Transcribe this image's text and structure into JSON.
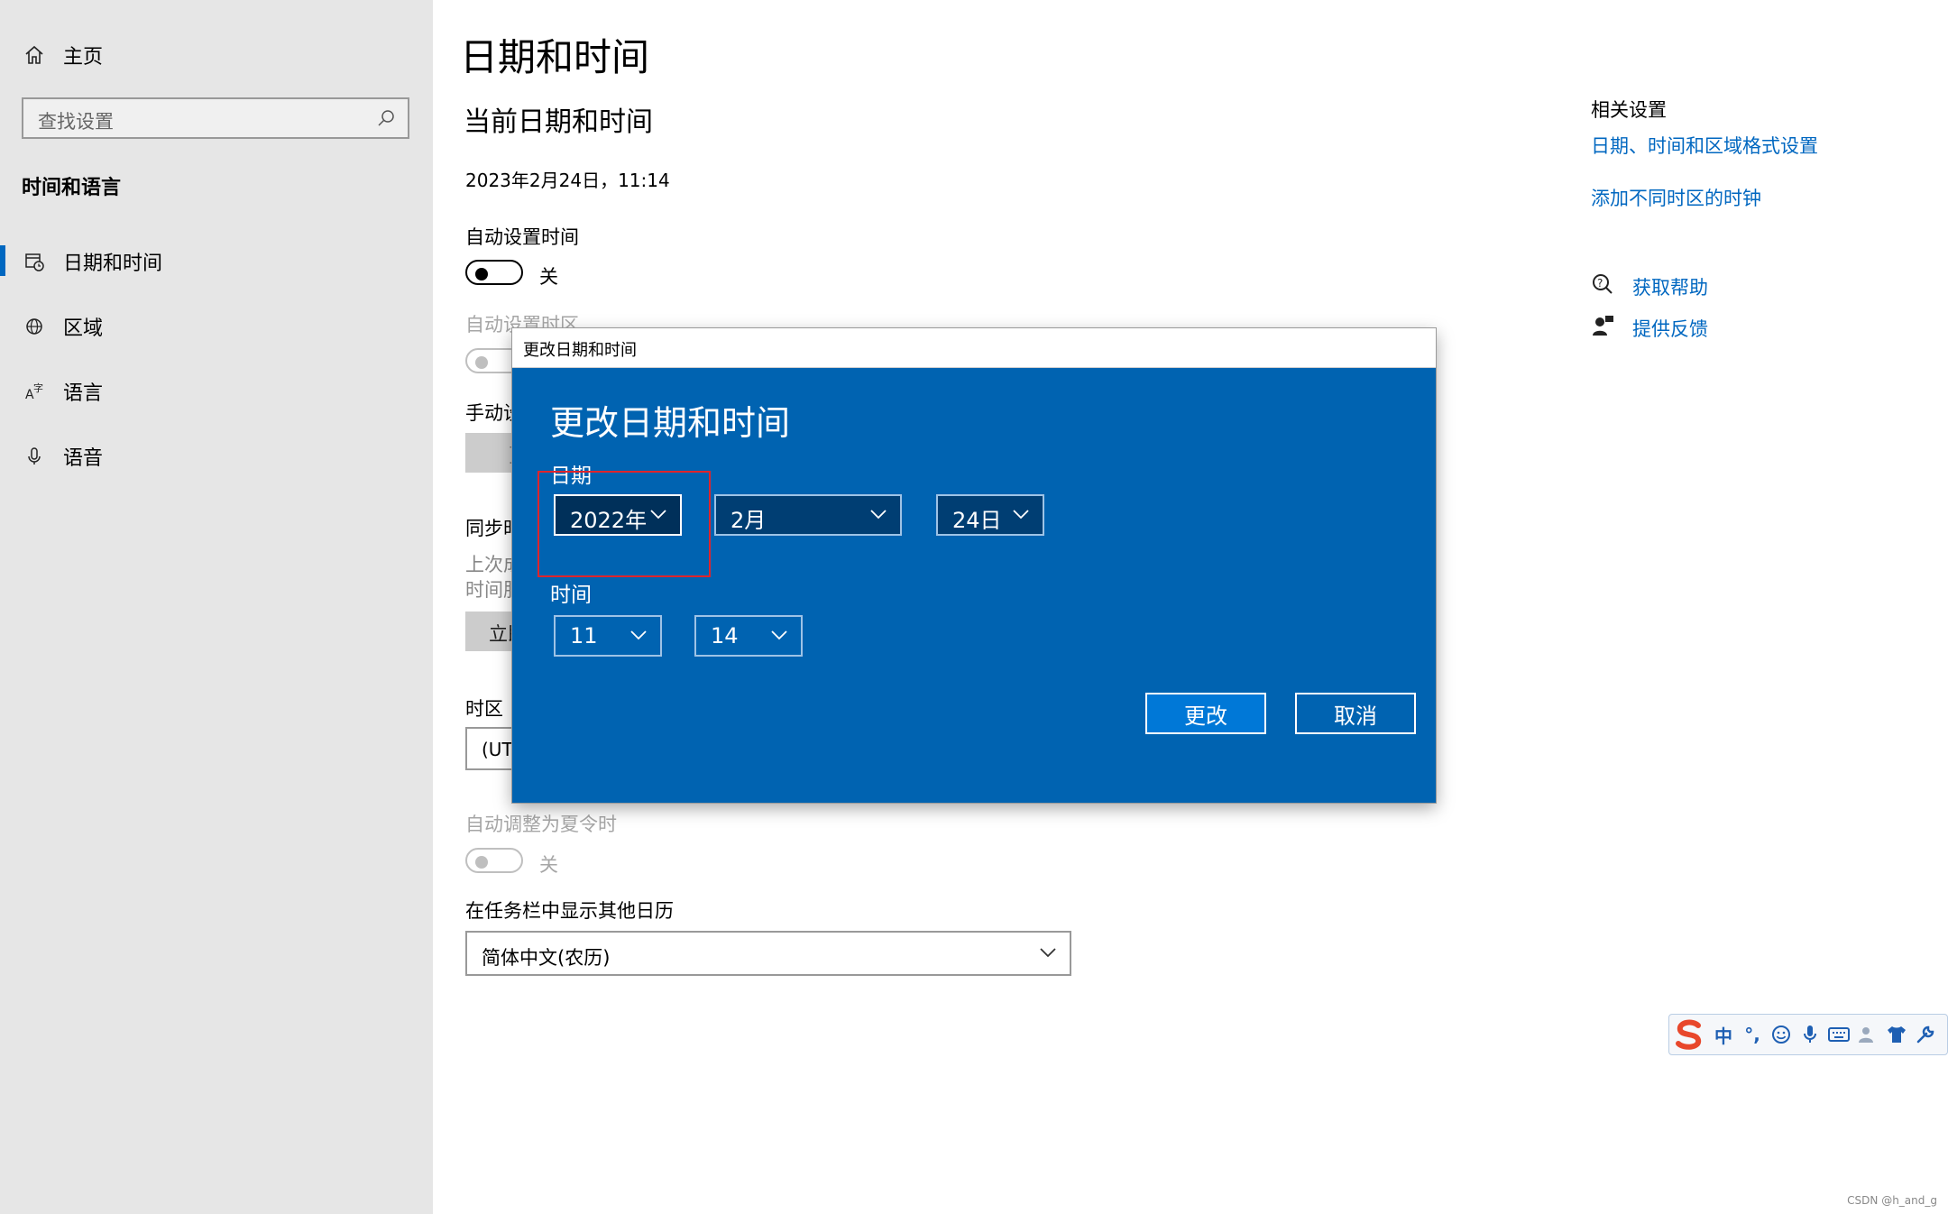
{
  "sidebar": {
    "home": "主页",
    "search_placeholder": "查找设置",
    "section_title": "时间和语言",
    "items": [
      {
        "label": "日期和时间",
        "icon": "calendar-clock-icon",
        "active": true
      },
      {
        "label": "区域",
        "icon": "globe-icon",
        "active": false
      },
      {
        "label": "语言",
        "icon": "language-icon",
        "active": false
      },
      {
        "label": "语音",
        "icon": "microphone-icon",
        "active": false
      }
    ]
  },
  "main": {
    "page_title": "日期和时间",
    "section_title": "当前日期和时间",
    "current_datetime": "2023年2月24日，11:14",
    "auto_time_label": "自动设置时间",
    "auto_time_state": "关",
    "auto_timezone_label": "自动设置时区",
    "manual_label_partial": "手动设",
    "manual_button_partial": "更",
    "sync_label_partial": "同步时",
    "sync_last_partial": "上次成",
    "sync_server_partial": "时间服",
    "sync_button_partial": "立即",
    "timezone_label": "时区",
    "timezone_value_partial": "(UTC",
    "dst_label": "自动调整为夏令时",
    "dst_state": "关",
    "taskbar_calendar_label": "在任务栏中显示其他日历",
    "taskbar_calendar_value": "简体中文(农历)"
  },
  "related": {
    "title": "相关设置",
    "link1": "日期、时间和区域格式设置",
    "link2": "添加不同时区的时钟",
    "help": "获取帮助",
    "feedback": "提供反馈"
  },
  "dialog": {
    "window_title": "更改日期和时间",
    "heading": "更改日期和时间",
    "date_label": "日期",
    "year": "2022年",
    "month": "2月",
    "day": "24日",
    "time_label": "时间",
    "hour": "11",
    "minute": "14",
    "change_button": "更改",
    "cancel_button": "取消"
  },
  "ime": {
    "mode": "中",
    "punct": "°,"
  },
  "watermark": "CSDN @h_and_g",
  "colors": {
    "accent": "#0067c0",
    "dialog_bg": "#0063b1",
    "highlight_border": "#e0242b"
  }
}
